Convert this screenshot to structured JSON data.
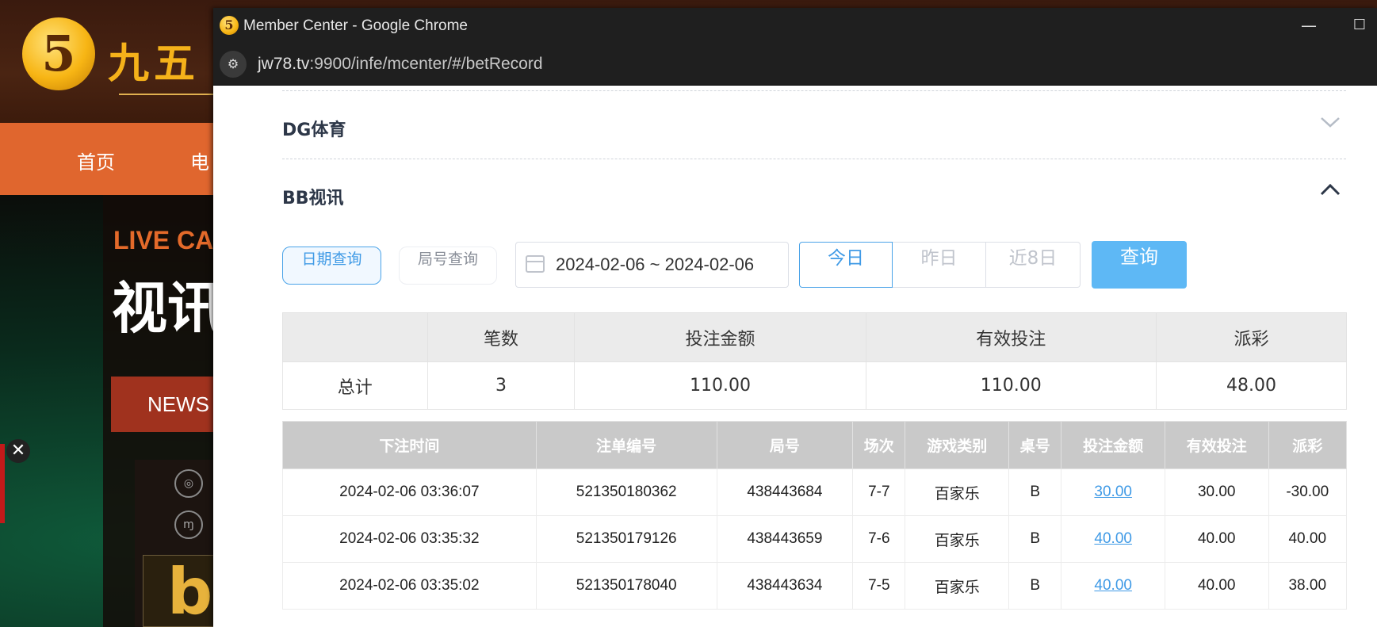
{
  "background_site": {
    "logo_text": "九五",
    "logo_glyph": "5",
    "nav": [
      "首页",
      "电"
    ],
    "hero_live": "LIVE CA",
    "hero_title": "视讯",
    "news_label": "NEWS",
    "close_glyph": "✕"
  },
  "window": {
    "title": "Member Center - Google Chrome",
    "favicon_glyph": "5",
    "minimize_glyph": "—",
    "maximize_glyph": "☐",
    "url_host": "jw78.tv",
    "url_rest": ":9900/infe/mcenter/#/betRecord"
  },
  "sections": {
    "dg_title": "DG体育",
    "bb_title": "BB视讯"
  },
  "filters": {
    "date_query_label": "日期查询",
    "round_query_label": "局号查询",
    "date_range": "2024-02-06 ~ 2024-02-06",
    "today_label": "今日",
    "yesterday_label": "昨日",
    "last8_label": "近8日",
    "search_label": "查询"
  },
  "summary": {
    "headers": [
      "",
      "笔数",
      "投注金额",
      "有效投注",
      "派彩"
    ],
    "row_label": "总计",
    "count": "3",
    "bet_amount": "110.00",
    "valid_bet": "110.00",
    "payout": "48.00"
  },
  "records": {
    "headers": [
      "下注时间",
      "注单编号",
      "局号",
      "场次",
      "游戏类别",
      "桌号",
      "投注金额",
      "有效投注",
      "派彩"
    ],
    "rows": [
      {
        "time": "2024-02-06 03:36:07",
        "bet_id": "521350180362",
        "round": "438443684",
        "session": "7-7",
        "game": "百家乐",
        "table": "B",
        "amount": "30.00",
        "valid": "30.00",
        "payout": "-30.00"
      },
      {
        "time": "2024-02-06 03:35:32",
        "bet_id": "521350179126",
        "round": "438443659",
        "session": "7-6",
        "game": "百家乐",
        "table": "B",
        "amount": "40.00",
        "valid": "40.00",
        "payout": "40.00"
      },
      {
        "time": "2024-02-06 03:35:02",
        "bet_id": "521350178040",
        "round": "438443634",
        "session": "7-5",
        "game": "百家乐",
        "table": "B",
        "amount": "40.00",
        "valid": "40.00",
        "payout": "38.00"
      }
    ]
  },
  "colors": {
    "accent": "#3f9ae6",
    "search_button": "#5eb8f5",
    "negative": "#e23c3c",
    "nav_orange": "#e0662e"
  }
}
